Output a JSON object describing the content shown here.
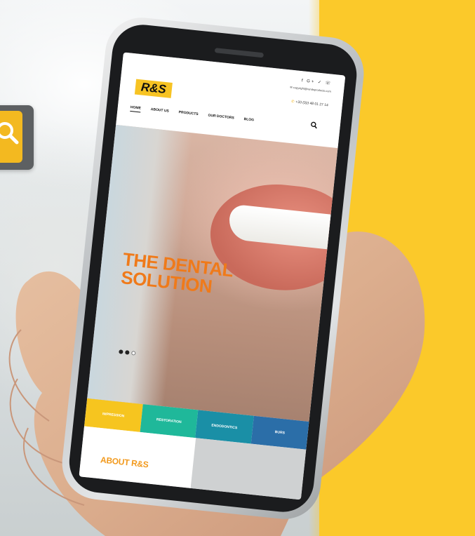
{
  "site": {
    "logo": "R&S",
    "social_icons": "f G+ ✓ ☏",
    "email": "✉ copyright@randsproducts.com",
    "phone": "+33 (0)3 48 01 27 14",
    "nav": [
      "HOME",
      "ABOUT US",
      "PRODUCTS",
      "OUR DOCTORS",
      "BLOG"
    ],
    "active_nav": "HOME"
  },
  "hero": {
    "title_line1": "THE DENTAL",
    "title_line2": "SOLUTION",
    "slides": 3,
    "active_slide": 2
  },
  "categories": [
    "IMPRESSION",
    "RESTORATION",
    "ENDODONTICS",
    "BURS"
  ],
  "about": {
    "title": "ABOUT R&S"
  },
  "colors": {
    "brand_yellow": "#f7c323",
    "title_orange": "#ef7a1a",
    "teal": "#1fb89a",
    "blue": "#2b6ea8"
  }
}
